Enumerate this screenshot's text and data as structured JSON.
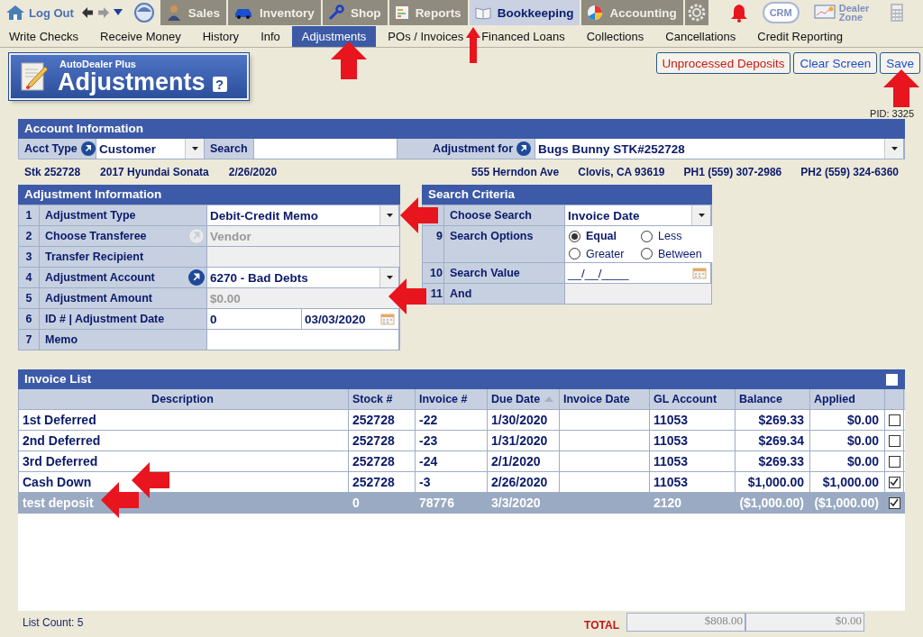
{
  "top_bar": {
    "logout": "Log Out",
    "tabs": [
      {
        "label": "Sales",
        "selected": false
      },
      {
        "label": "Inventory",
        "selected": false
      },
      {
        "label": "Shop",
        "selected": false
      },
      {
        "label": "Reports",
        "selected": false
      },
      {
        "label": "Bookkeeping",
        "selected": true
      },
      {
        "label": "Accounting",
        "selected": false
      }
    ],
    "tools": [
      {
        "kind": "gear"
      },
      {
        "kind": "bell"
      },
      {
        "kind": "crm",
        "label": "CRM"
      },
      {
        "kind": "dealer_zone",
        "label": "Dealer Zone"
      },
      {
        "kind": "calculator"
      }
    ]
  },
  "subnav": [
    {
      "label": "Write Checks",
      "selected": false
    },
    {
      "label": "Receive Money",
      "selected": false
    },
    {
      "label": "History",
      "selected": false
    },
    {
      "label": "Info",
      "selected": false
    },
    {
      "label": "Adjustments",
      "selected": true
    },
    {
      "label": "POs / Invoices",
      "selected": false
    },
    {
      "label": "Financed Loans",
      "selected": false
    },
    {
      "label": "Collections",
      "selected": false
    },
    {
      "label": "Cancellations",
      "selected": false
    },
    {
      "label": "Credit Reporting",
      "selected": false
    }
  ],
  "title": {
    "brand": "AutoDealer Plus",
    "heading": "Adjustments",
    "help": "?"
  },
  "buttons": [
    {
      "label": "Unprocessed Deposits",
      "kind": "alert"
    },
    {
      "label": "Clear Screen",
      "kind": "normal"
    },
    {
      "label": "Save",
      "kind": "normal"
    }
  ],
  "pid": "PID: 3325",
  "account": {
    "title": "Account Information",
    "acct_type_label": "Acct Type",
    "acct_type_value": "Customer",
    "search_label": "Search",
    "adjustment_for_label": "Adjustment for",
    "adjustment_for_value": "Bugs Bunny  STK#252728",
    "info_left": [
      "Stk 252728",
      "2017 Hyundai Sonata",
      "2/26/2020"
    ],
    "info_right": [
      "555 Herndon Ave",
      "Clovis, CA 93619",
      "PH1 (559) 307-2986",
      "PH2 (559) 324-6360"
    ]
  },
  "adjustment": {
    "title": "Adjustment Information",
    "rows": [
      {
        "num": "1",
        "label": "Adjustment Type",
        "kind": "select",
        "value": "Debit-Credit Memo"
      },
      {
        "num": "2",
        "label": "Choose Transferee",
        "kind": "disabled",
        "value": "Vendor",
        "picker_active": false
      },
      {
        "num": "3",
        "label": "Transfer Recipient",
        "kind": "disabled"
      },
      {
        "num": "4",
        "label": "Adjustment Account",
        "kind": "select",
        "value": "6270 - Bad Debts",
        "picker_active": true
      },
      {
        "num": "5",
        "label": "Adjustment Amount",
        "kind": "disabled",
        "value": "$0.00"
      },
      {
        "num": "6",
        "label": "ID # | Adjustment Date",
        "kind": "date_pair",
        "value": "0",
        "date": "03/03/2020"
      },
      {
        "num": "7",
        "label": "Memo",
        "kind": "text"
      }
    ]
  },
  "search": {
    "title": "Search Criteria",
    "rows": [
      {
        "label": "Choose Search",
        "kind": "select",
        "value": "Invoice Date"
      },
      {
        "num": "9",
        "label": "Search Options",
        "kind": "radios",
        "options": [
          {
            "label": "Equal",
            "selected": true
          },
          {
            "label": "Less",
            "selected": false
          },
          {
            "label": "Greater",
            "selected": false
          },
          {
            "label": "Between",
            "selected": false
          }
        ]
      },
      {
        "num": "10",
        "label": "Search Value",
        "kind": "date",
        "value": "__/__/____"
      },
      {
        "num": "11",
        "label": "And",
        "kind": "disabled"
      }
    ]
  },
  "invoices": {
    "title": "Invoice List",
    "all_checked": false,
    "columns": [
      "Description",
      "Stock #",
      "Invoice #",
      "Due Date",
      "Invoice Date",
      "GL Account",
      "Balance",
      "Applied"
    ],
    "rows": [
      {
        "cells": [
          "1st Deferred",
          "252728",
          "-22",
          "1/30/2020",
          "",
          "11053",
          "$269.33",
          "$0.00"
        ],
        "checked": false,
        "selected": false
      },
      {
        "cells": [
          "2nd Deferred",
          "252728",
          "-23",
          "1/31/2020",
          "",
          "11053",
          "$269.34",
          "$0.00"
        ],
        "checked": false,
        "selected": false
      },
      {
        "cells": [
          "3rd Deferred",
          "252728",
          "-24",
          "2/1/2020",
          "",
          "11053",
          "$269.33",
          "$0.00"
        ],
        "checked": false,
        "selected": false
      },
      {
        "cells": [
          "Cash Down",
          "252728",
          "-3",
          "2/26/2020",
          "",
          "11053",
          "$1,000.00",
          "$1,000.00"
        ],
        "checked": true,
        "selected": false
      },
      {
        "cells": [
          "test deposit",
          "0",
          "78776",
          "3/3/2020",
          "",
          "2120",
          "($1,000.00)",
          "($1,000.00)"
        ],
        "checked": true,
        "selected": true
      }
    ]
  },
  "footer": {
    "list_count": "List Count:  5",
    "total_label": "TOTAL",
    "totals": [
      "$808.00",
      "$0.00"
    ]
  }
}
